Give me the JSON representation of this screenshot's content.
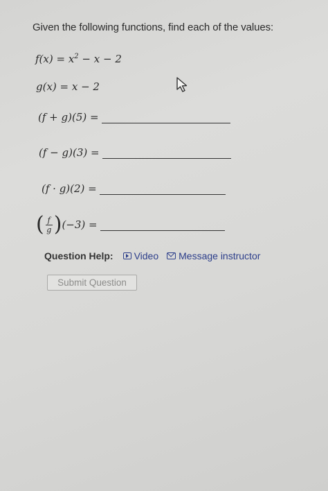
{
  "question": {
    "prompt": "Given the following functions, find each of the values:",
    "f_def": "f(x) = x",
    "f_exp": "2",
    "f_rest": " − x − 2",
    "g_def": "g(x) = x − 2",
    "items": [
      {
        "expr": "(f + g)(5) =",
        "answer": ""
      },
      {
        "expr": "(f − g)(3) =",
        "answer": ""
      },
      {
        "expr": "(f · g)(2) =",
        "answer": ""
      },
      {
        "expr_num": "f",
        "expr_den": "g",
        "expr_tail": "(−3) =",
        "answer": ""
      }
    ]
  },
  "help": {
    "label": "Question Help:",
    "video": "Video",
    "message": "Message instructor"
  },
  "submit": {
    "label": "Submit Question"
  },
  "colors": {
    "link": "#2b3d8a",
    "text": "#2a2a2a",
    "disabled": "#8c8c8a"
  }
}
